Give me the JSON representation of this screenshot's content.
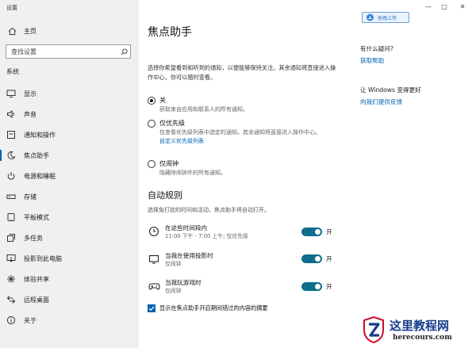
{
  "window": {
    "title": "设置"
  },
  "sidebar": {
    "home_label": "主页",
    "search_placeholder": "查找设置",
    "section_label": "系统",
    "items": [
      {
        "label": "显示",
        "icon": "monitor-icon"
      },
      {
        "label": "声音",
        "icon": "speaker-icon"
      },
      {
        "label": "通知和操作",
        "icon": "notification-icon"
      },
      {
        "label": "焦点助手",
        "icon": "moon-icon",
        "active": true
      },
      {
        "label": "电源和睡眠",
        "icon": "power-icon"
      },
      {
        "label": "存储",
        "icon": "storage-icon"
      },
      {
        "label": "平板模式",
        "icon": "tablet-icon"
      },
      {
        "label": "多任务",
        "icon": "multitask-icon"
      },
      {
        "label": "投影到此电脑",
        "icon": "project-icon"
      },
      {
        "label": "体验共享",
        "icon": "share-icon"
      },
      {
        "label": "远程桌面",
        "icon": "remote-icon"
      },
      {
        "label": "关于",
        "icon": "info-icon"
      }
    ]
  },
  "main": {
    "title": "焦点助手",
    "intro": "选择你希望看到和听到的通知，以便能够保持关注。其余通知将直接进入操作中心，你可以随时查看。",
    "options": [
      {
        "title": "关",
        "desc": "获取来自应用和联系人的所有通知。",
        "selected": true
      },
      {
        "title": "仅优先级",
        "desc": "仅查看优先级列表中选定的通知。其余通知将直接进入操作中心。",
        "link": "自定义优先级列表",
        "selected": false
      },
      {
        "title": "仅闹钟",
        "desc": "隐藏除闹钟外的所有通知。",
        "selected": false
      }
    ],
    "auto_rules": {
      "heading": "自动规则",
      "subtitle": "选择免打扰的时间和活动，焦点助手将自动打开。",
      "rules": [
        {
          "title": "在这些时间段内",
          "desc": "11:00 下午 - 7:00 上午; 仅优先级",
          "state": "开",
          "icon": "clock-icon"
        },
        {
          "title": "当我在使用投影时",
          "desc": "仅闹钟",
          "state": "开",
          "icon": "display-icon"
        },
        {
          "title": "当我玩游戏时",
          "desc": "仅闹钟",
          "state": "开",
          "icon": "gamepad-icon"
        }
      ],
      "summary_label": "显示在焦点助手开启期间错过的内容的摘要",
      "summary_checked": true
    }
  },
  "right": {
    "upload_label": "拖拽上传",
    "q_heading": "有什么疑问?",
    "q_link": "获取帮助",
    "fb_heading": "让 Windows 变得更好",
    "fb_link": "向我们提供反馈"
  },
  "window_controls": {
    "minimize": "—",
    "maximize": "□",
    "close": "✕"
  },
  "watermark": {
    "site_name": "这里教程网",
    "site_url": "herecours.com"
  },
  "colors": {
    "accent": "#0063b1",
    "toggle": "#0e6e8c",
    "sidebar_bg": "#f0f0f0"
  }
}
